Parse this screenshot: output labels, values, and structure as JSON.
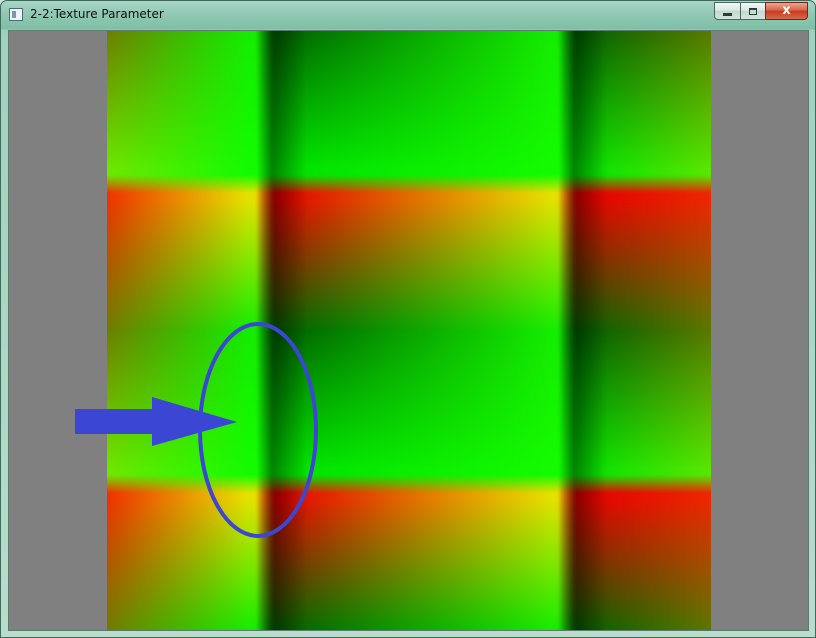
{
  "window": {
    "title": "2-2:Texture Parameter",
    "controls": {
      "minimize_icon": "minimize-icon",
      "maximize_icon": "maximize-icon",
      "close_glyph": "x"
    }
  },
  "colors": {
    "client_background": "#808080",
    "annotation": "#3b47d4",
    "green": "#00e000",
    "red": "#e00000",
    "yellow": "#e0e000",
    "black": "#000000"
  },
  "annotation": {
    "shapes": [
      "ellipse",
      "arrow"
    ]
  }
}
